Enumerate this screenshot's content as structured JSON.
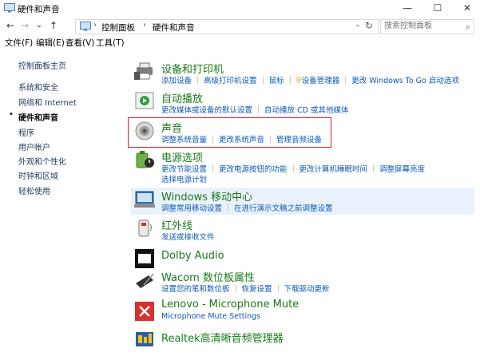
{
  "window": {
    "title": "硬件和声音",
    "minimize": "—",
    "maximize": "☐",
    "close": "✕"
  },
  "nav_buttons": {
    "back": "←",
    "forward": "→",
    "history": "⌄",
    "up": "↑"
  },
  "breadcrumb": {
    "items": [
      "控制面板",
      "硬件和声音"
    ],
    "separator": "›"
  },
  "search": {
    "placeholder": "搜索控制面板",
    "icon": "search-icon"
  },
  "menu": [
    "文件(F)",
    "编辑(E)",
    "查看(V)",
    "工具(T)"
  ],
  "sidebar": {
    "items": [
      {
        "label": "控制面板主页",
        "current": false
      },
      {
        "label": "系统和安全",
        "current": false
      },
      {
        "label": "网络和 Internet",
        "current": false
      },
      {
        "label": "硬件和声音",
        "current": true
      },
      {
        "label": "程序",
        "current": false
      },
      {
        "label": "用户帐户",
        "current": false
      },
      {
        "label": "外观和个性化",
        "current": false
      },
      {
        "label": "时钟和区域",
        "current": false
      },
      {
        "label": "轻松使用",
        "current": false
      }
    ]
  },
  "categories": [
    {
      "title": "设备和打印机",
      "icon": "printer-icon",
      "links": [
        [
          "添加设备",
          "高级打印机设置",
          "鼠标",
          "设备管理器",
          "更改 Windows To Go 启动选项"
        ]
      ]
    },
    {
      "title": "自动播放",
      "icon": "autoplay-icon",
      "links": [
        [
          "更改媒体或设备的默认设置",
          "自动播放 CD 或其他媒体"
        ]
      ]
    },
    {
      "title": "声音",
      "icon": "speaker-icon",
      "links": [
        [
          "调整系统音量",
          "更改系统声音",
          "管理音频设备"
        ]
      ]
    },
    {
      "title": "电源选项",
      "icon": "power-icon",
      "links": [
        [
          "更改节能设置",
          "更改电源按钮的功能",
          "更改计算机睡眠时间",
          "调整屏幕亮度"
        ],
        [
          "选择电源计划"
        ]
      ]
    },
    {
      "title": "Windows 移动中心",
      "icon": "mobility-center-icon",
      "links": [
        [
          "调整常用移动设置",
          "在进行演示文稿之前调整设置"
        ]
      ]
    },
    {
      "title": "红外线",
      "icon": "infrared-icon",
      "links": [
        [
          "发送或接收文件"
        ]
      ]
    },
    {
      "title": "Dolby Audio",
      "icon": "dolby-icon",
      "links": []
    },
    {
      "title": "Wacom 数位板属性",
      "icon": "tablet-icon",
      "links": [
        [
          "设置您的笔和数位板",
          "恢复设置",
          "下载驱动更新"
        ]
      ]
    },
    {
      "title": "Lenovo - Microphone Mute",
      "icon": "microphone-mute-icon",
      "links": [
        [
          "Microphone Mute Settings"
        ]
      ]
    },
    {
      "title": "Realtek高清晰音频管理器",
      "icon": "realtek-audio-icon",
      "links": []
    }
  ],
  "colors": {
    "title_green": "#1a7a1a",
    "link_blue": "#0b58b8",
    "highlight": "#e9f2fb",
    "red_frame": "#e02020"
  }
}
